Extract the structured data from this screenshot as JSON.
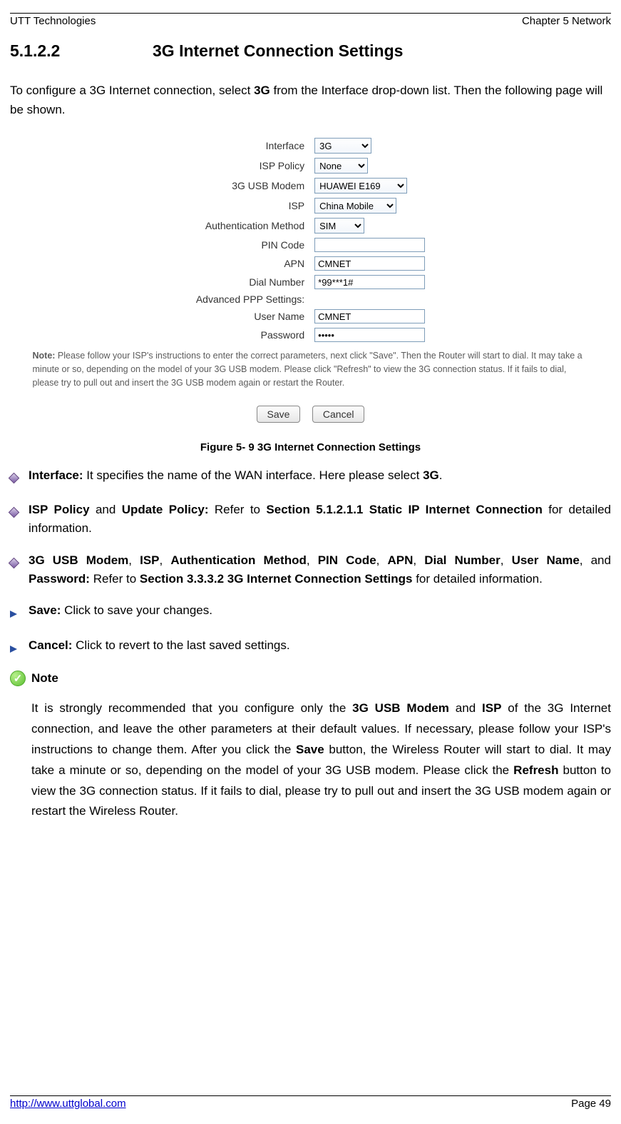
{
  "header": {
    "left": "UTT Technologies",
    "right": "Chapter 5 Network"
  },
  "section": {
    "num": "5.1.2.2",
    "title": "3G Internet Connection Settings"
  },
  "intro_pre": "To configure a 3G Internet connection, select ",
  "intro_bold": "3G",
  "intro_post": " from the Interface drop-down list. Then the following page will be shown.",
  "form": {
    "lbl_interface": "Interface",
    "val_interface": "3G",
    "lbl_isppolicy": "ISP Policy",
    "val_isppolicy": "None",
    "lbl_modem": "3G USB Modem",
    "val_modem": "HUAWEI E169",
    "lbl_isp": "ISP",
    "val_isp": "China Mobile",
    "lbl_auth": "Authentication Method",
    "val_auth": "SIM",
    "lbl_pin": "PIN Code",
    "val_pin": "",
    "lbl_apn": "APN",
    "val_apn": "CMNET",
    "lbl_dial": "Dial Number",
    "val_dial": "*99***1#",
    "lbl_adv": "Advanced PPP Settings:",
    "lbl_user": "User Name",
    "val_user": "CMNET",
    "lbl_pass": "Password",
    "val_pass": "•••••"
  },
  "fignote_b": "Note:",
  "fignote": " Please follow your ISP's instructions to enter the correct parameters, next click \"Save\". Then the Router will start to dial. It may take a minute or so, depending on the model of your 3G USB modem. Please click \"Refresh\" to view the 3G connection status. If it fails to dial, please try to pull out and insert the 3G USB modem again or restart the Router.",
  "buttons": {
    "save": "Save",
    "cancel": "Cancel"
  },
  "figcap": "Figure 5- 9 3G Internet Connection Settings",
  "bullets": {
    "b1_b1": "Interface:",
    "b1_t1": " It specifies the name of the WAN interface. Here please select ",
    "b1_b2": "3G",
    "b1_t2": ".",
    "b2_b1": "ISP Policy",
    "b2_t1": " and ",
    "b2_b2": "Update Policy:",
    "b2_t2": " Refer to ",
    "b2_b3": "Section 5.1.2.1.1 Static IP Internet Connection",
    "b2_t3": " for detailed information.",
    "b3_b1": "3G USB Modem",
    "b3_t1": ", ",
    "b3_b2": "ISP",
    "b3_t2": ", ",
    "b3_b3": "Authentication Method",
    "b3_t3": ", ",
    "b3_b4": "PIN Code",
    "b3_t4": ", ",
    "b3_b5": "APN",
    "b3_t5": ", ",
    "b3_b6": "Dial Number",
    "b3_t6": ", ",
    "b3_b7": "User Name",
    "b3_t7": ", and ",
    "b3_b8": "Password:",
    "b3_t8": " Refer to ",
    "b3_b9": "Section 3.3.3.2 3G Internet Connection Settings",
    "b3_t9": " for detailed information.",
    "b4_b1": "Save:",
    "b4_t1": " Click to save your changes.",
    "b5_b1": "Cancel:",
    "b5_t1": " Click to revert to the last saved settings."
  },
  "notehead": "Note",
  "note_t1": "It is strongly recommended that you configure only the ",
  "note_b1": "3G USB Modem",
  "note_t2": " and ",
  "note_b2": "ISP",
  "note_t3": " of the 3G Internet connection, and leave the other parameters at their default values. If necessary, please follow your ISP's instructions to change them. After you click the ",
  "note_b3": "Save",
  "note_t4": " button, the Wireless Router will start to dial. It may take a minute or so, depending on the model of your 3G USB modem. Please click the ",
  "note_b4": "Refresh",
  "note_t5": " button to view the 3G connection status. If it fails to dial, please try to pull out and insert the 3G USB modem again or restart the Wireless Router.",
  "footer": {
    "url": "http://www.uttglobal.com",
    "page": "Page 49"
  }
}
